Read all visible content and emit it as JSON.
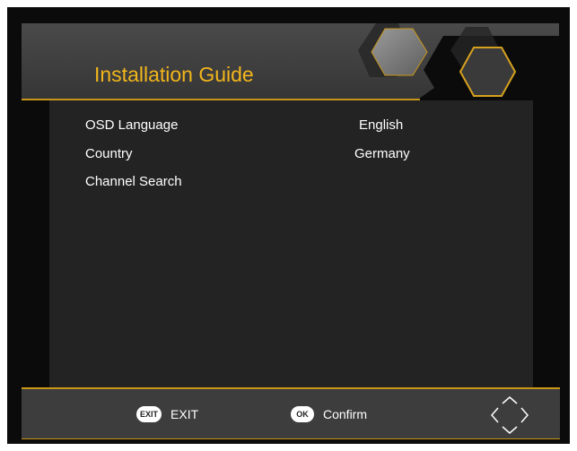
{
  "header": {
    "title": "Installation Guide"
  },
  "settings": [
    {
      "label": "OSD Language",
      "value": "English"
    },
    {
      "label": "Country",
      "value": "Germany"
    },
    {
      "label": "Channel Search",
      "value": ""
    }
  ],
  "footer": {
    "exit_key": "EXIT",
    "exit_label": "EXIT",
    "ok_key": "OK",
    "ok_label": "Confirm",
    "nav_icon": "direction-pad-icon"
  },
  "colors": {
    "accent": "#f2b61c",
    "border": "#c9961a",
    "background": "#0b0b0b",
    "panel": "#232323",
    "header": "#3a3a3a",
    "footer": "#3d3d3d"
  }
}
